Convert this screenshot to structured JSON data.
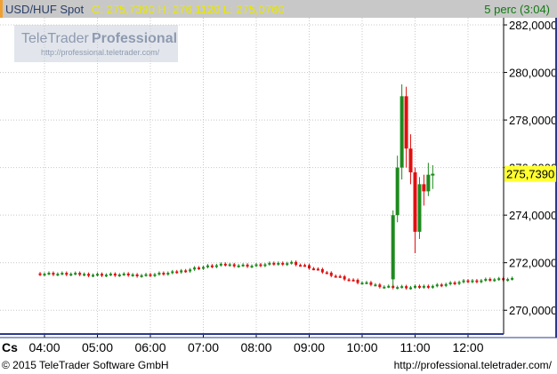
{
  "header": {
    "symbol": "USD/HUF Spot",
    "quote": "C: 275,7390 H: 276,1120 L: 275,0760",
    "period": "5 perc (3:04)"
  },
  "watermark": {
    "brand_regular": "TeleTrader",
    "brand_bold": "Professional",
    "url": "http://professional.teletrader.com/"
  },
  "footer": {
    "copyright": "© 2015 TeleTrader Software GmbH",
    "url": "http://professional.teletrader.com/"
  },
  "colors": {
    "up": "#1e8a1e",
    "down": "#e01010",
    "grid": "#c8c8c8",
    "axis_frame": "#2b3a8c",
    "last_price_bg": "#ffff30"
  },
  "chart_data": {
    "type": "candlestick",
    "interval": "5 perc",
    "x_axis_label": "Cs",
    "x_ticks": [
      "04:00",
      "05:00",
      "06:00",
      "07:00",
      "08:00",
      "09:00",
      "10:00",
      "11:00",
      "12:00"
    ],
    "y_ticks": [
      "270,0000",
      "272,0000",
      "274,0000",
      "276,0000",
      "278,0000",
      "280,0000",
      "282,0000"
    ],
    "ylim": [
      269.0,
      282.3
    ],
    "grid": true,
    "last_price": 275.739,
    "last_price_label": "275,7390",
    "start_time": "03:55",
    "segments": [
      {
        "name": "pre-spike",
        "start_index": 0,
        "points": [
          {
            "i": 0,
            "p": 271.55
          },
          {
            "i": 12,
            "p": 271.5
          },
          {
            "i": 24,
            "p": 271.48
          },
          {
            "i": 30,
            "p": 271.58
          },
          {
            "i": 36,
            "p": 271.8
          },
          {
            "i": 42,
            "p": 271.92
          },
          {
            "i": 48,
            "p": 271.87
          },
          {
            "i": 54,
            "p": 271.97
          },
          {
            "i": 57,
            "p": 272.0
          },
          {
            "i": 60,
            "p": 271.85
          },
          {
            "i": 66,
            "p": 271.5
          },
          {
            "i": 72,
            "p": 271.18
          },
          {
            "i": 78,
            "p": 271.0
          },
          {
            "i": 84,
            "p": 270.95
          },
          {
            "i": 90,
            "p": 271.05
          },
          {
            "i": 96,
            "p": 271.2
          },
          {
            "i": 102,
            "p": 271.3
          },
          {
            "i": 107,
            "p": 271.3
          }
        ]
      }
    ],
    "candles_after": [
      {
        "time": "10:35",
        "open": 271.3,
        "high": 274.2,
        "low": 271.0,
        "close": 274.0
      },
      {
        "time": "10:40",
        "open": 274.0,
        "high": 276.5,
        "low": 273.7,
        "close": 276.0
      },
      {
        "time": "10:45",
        "open": 276.0,
        "high": 279.5,
        "low": 275.5,
        "close": 279.0
      },
      {
        "time": "10:50",
        "open": 279.0,
        "high": 279.4,
        "low": 276.0,
        "close": 276.8
      },
      {
        "time": "10:55",
        "open": 276.8,
        "high": 277.4,
        "low": 275.3,
        "close": 275.8
      },
      {
        "time": "11:00",
        "open": 275.8,
        "high": 276.0,
        "low": 272.4,
        "close": 273.3
      },
      {
        "time": "11:05",
        "open": 273.3,
        "high": 275.6,
        "low": 273.0,
        "close": 275.3
      },
      {
        "time": "11:10",
        "open": 275.3,
        "high": 275.7,
        "low": 274.4,
        "close": 275.0
      },
      {
        "time": "11:15",
        "open": 275.0,
        "high": 276.2,
        "low": 274.8,
        "close": 275.7
      },
      {
        "time": "11:20",
        "open": 275.7,
        "high": 276.1,
        "low": 275.1,
        "close": 275.74
      }
    ]
  }
}
